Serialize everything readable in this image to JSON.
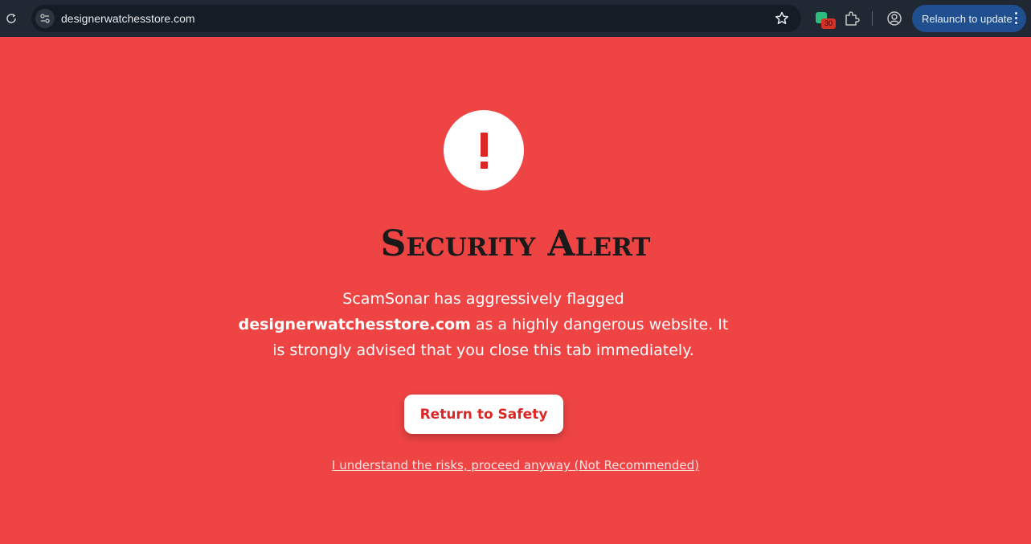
{
  "browser": {
    "url": "designerwatchesstore.com",
    "extension_badge": "30",
    "relaunch_label": "Relaunch to update"
  },
  "alert": {
    "title": "Security Alert",
    "message_before": "ScamSonar has aggressively flagged ",
    "flagged_domain": "designerwatchesstore.com",
    "message_after": " as a highly dangerous website. It is strongly advised that you close this tab immediately.",
    "primary_button": "Return to Safety",
    "proceed_link": "I understand the risks, proceed anyway (Not Recommended)"
  },
  "colors": {
    "background": "#ef4444",
    "toolbar": "#202833",
    "accent_red": "#dc2626",
    "relaunch_blue": "#1f4f8f"
  },
  "icons": [
    "reload-icon",
    "site-info-icon",
    "star-icon",
    "extension-icon",
    "puzzle-icon",
    "profile-icon",
    "kebab-menu-icon",
    "exclamation-icon"
  ]
}
